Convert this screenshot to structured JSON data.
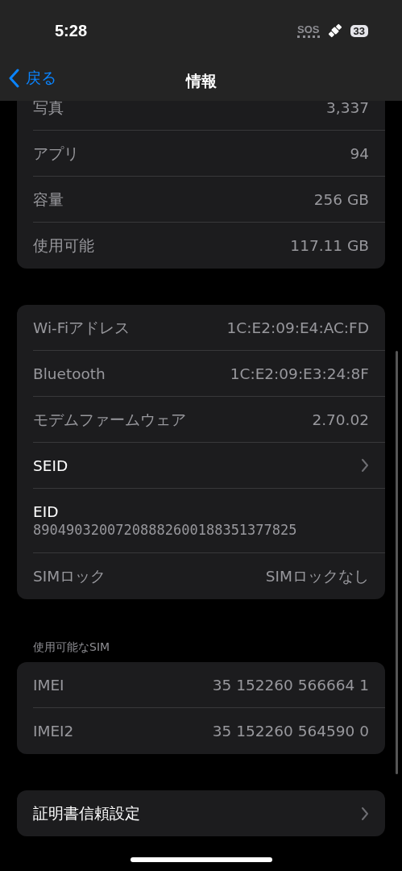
{
  "status_bar": {
    "time": "5:28",
    "sos": "SOS",
    "battery": "33"
  },
  "nav": {
    "back": "戻る",
    "title": "情報"
  },
  "groups": [
    {
      "rows": [
        {
          "kind": "value",
          "label": "写真",
          "value": "3,337"
        },
        {
          "kind": "value",
          "label": "アプリ",
          "value": "94"
        },
        {
          "kind": "value",
          "label": "容量",
          "value": "256 GB"
        },
        {
          "kind": "value",
          "label": "使用可能",
          "value": "117.11 GB"
        }
      ]
    },
    {
      "rows": [
        {
          "kind": "value",
          "label": "Wi-Fiアドレス",
          "value": "1C:E2:09:E4:AC:FD"
        },
        {
          "kind": "value",
          "label": "Bluetooth",
          "value": "1C:E2:09:E3:24:8F"
        },
        {
          "kind": "value",
          "label": "モデムファームウェア",
          "value": "2.70.02"
        },
        {
          "kind": "chevron",
          "label": "SEID"
        },
        {
          "kind": "stacked",
          "label": "EID",
          "value": "89049032007208882600188351377825"
        },
        {
          "kind": "value",
          "label": "SIMロック",
          "value": "SIMロックなし"
        }
      ]
    },
    {
      "header": "使用可能なSIM",
      "rows": [
        {
          "kind": "value",
          "label": "IMEI",
          "value": "35 152260 566664 1"
        },
        {
          "kind": "value",
          "label": "IMEI2",
          "value": "35 152260 564590 0"
        }
      ]
    },
    {
      "rows": [
        {
          "kind": "chevron",
          "label": "証明書信頼設定"
        }
      ]
    }
  ]
}
